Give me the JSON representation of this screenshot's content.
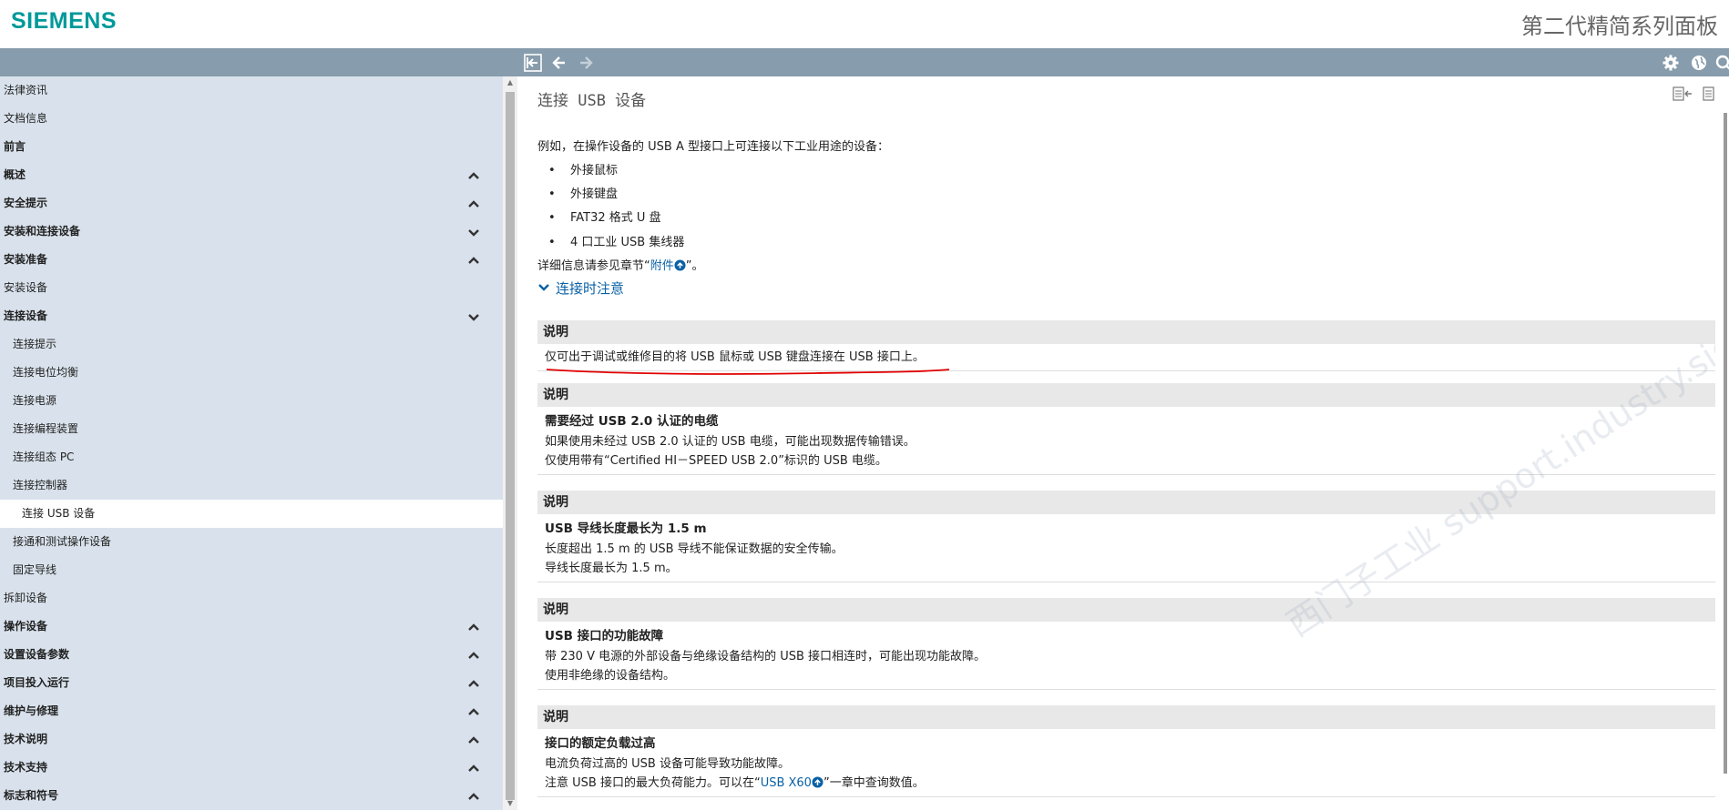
{
  "header": {
    "logo": "SIEMENS",
    "product_title": "第二代精简系列面板"
  },
  "toolbar": {
    "left_buttons": [
      "sync-toc-icon",
      "back-icon",
      "forward-icon"
    ],
    "right_buttons": [
      "settings-icon",
      "globe-icon",
      "search-icon"
    ]
  },
  "sidebar": {
    "items": [
      {
        "label": "法律资讯",
        "indent": 0,
        "bold": false,
        "chevron": ""
      },
      {
        "label": "文档信息",
        "indent": 0,
        "bold": false,
        "chevron": ""
      },
      {
        "label": "前言",
        "indent": 0,
        "bold": true,
        "chevron": ""
      },
      {
        "label": "概述",
        "indent": 0,
        "bold": true,
        "chevron": "up"
      },
      {
        "label": "安全提示",
        "indent": 0,
        "bold": true,
        "chevron": "up"
      },
      {
        "label": "安装和连接设备",
        "indent": 0,
        "bold": true,
        "chevron": "down"
      },
      {
        "label": "安装准备",
        "indent": 1,
        "bold": true,
        "chevron": "up"
      },
      {
        "label": "安装设备",
        "indent": 1,
        "bold": false,
        "chevron": ""
      },
      {
        "label": "连接设备",
        "indent": 1,
        "bold": true,
        "chevron": "down"
      },
      {
        "label": "连接提示",
        "indent": 2,
        "bold": false,
        "chevron": ""
      },
      {
        "label": "连接电位均衡",
        "indent": 2,
        "bold": false,
        "chevron": ""
      },
      {
        "label": "连接电源",
        "indent": 2,
        "bold": false,
        "chevron": ""
      },
      {
        "label": "连接编程装置",
        "indent": 2,
        "bold": false,
        "chevron": ""
      },
      {
        "label": "连接组态 PC",
        "indent": 2,
        "bold": false,
        "chevron": ""
      },
      {
        "label": "连接控制器",
        "indent": 2,
        "bold": false,
        "chevron": ""
      },
      {
        "label": "连接 USB 设备",
        "indent": 3,
        "bold": false,
        "chevron": "",
        "active": true
      },
      {
        "label": "接通和测试操作设备",
        "indent": 2,
        "bold": false,
        "chevron": ""
      },
      {
        "label": "固定导线",
        "indent": 2,
        "bold": false,
        "chevron": ""
      },
      {
        "label": "拆卸设备",
        "indent": 1,
        "bold": false,
        "chevron": ""
      },
      {
        "label": "操作设备",
        "indent": 0,
        "bold": true,
        "chevron": "up"
      },
      {
        "label": "设置设备参数",
        "indent": 0,
        "bold": true,
        "chevron": "up"
      },
      {
        "label": "项目投入运行",
        "indent": 0,
        "bold": true,
        "chevron": "up"
      },
      {
        "label": "维护与修理",
        "indent": 0,
        "bold": true,
        "chevron": "up"
      },
      {
        "label": "技术说明",
        "indent": 0,
        "bold": true,
        "chevron": "up"
      },
      {
        "label": "技术支持",
        "indent": 0,
        "bold": true,
        "chevron": "up"
      },
      {
        "label": "标志和符号",
        "indent": 0,
        "bold": true,
        "chevron": "up"
      }
    ]
  },
  "content": {
    "title": "连接 USB 设备",
    "intro": "例如，在操作设备的 USB A 型接口上可连接以下工业用途的设备：",
    "bullets": [
      "外接鼠标",
      "外接键盘",
      "FAT32 格式 U 盘",
      "4 口工业 USB 集线器"
    ],
    "ref_prefix": "详细信息请参见章节“",
    "ref_link": "附件",
    "ref_suffix": "”。",
    "toggle_label": "连接时注意",
    "notes": [
      {
        "head": "说明",
        "sub": "",
        "lines": [
          "仅可出于调试或维修目的将 USB 鼠标或 USB 键盘连接在 USB 接口上。"
        ]
      },
      {
        "head": "说明",
        "sub": "需要经过 USB 2.0 认证的电缆",
        "lines": [
          "如果使用未经过 USB 2.0 认证的 USB 电缆，可能出现数据传输错误。",
          "仅使用带有“Certified HI－SPEED USB  2.0”标识的 USB 电缆。"
        ]
      },
      {
        "head": "说明",
        "sub": "USB 导线长度最长为 1.5 m",
        "lines": [
          "长度超出 1.5 m 的 USB 导线不能保证数据的安全传输。",
          "导线长度最长为 1.5  m。"
        ]
      },
      {
        "head": "说明",
        "sub": "USB 接口的功能故障",
        "lines": [
          "带 230  V 电源的外部设备与绝缘设备结构的 USB 接口相连时，可能出现功能故障。",
          "使用非绝缘的设备结构。"
        ]
      },
      {
        "head": "说明",
        "sub": "接口的额定负载过高",
        "lines": [
          "电流负荷过高的 USB 设备可能导致功能故障。"
        ]
      }
    ],
    "last_line_prefix": "注意 USB 接口的最大负荷能力。可以在“",
    "last_line_link": "USB X60",
    "last_line_suffix": "”一章中查询数值。",
    "watermark": "西门子工业 support.industry.siemens.com/cs"
  },
  "colors": {
    "brand": "#009999",
    "toolbar": "#879cac",
    "sidebar_bg": "#d9e2ec",
    "link": "#0a61a5",
    "annotation": "#e00000"
  }
}
